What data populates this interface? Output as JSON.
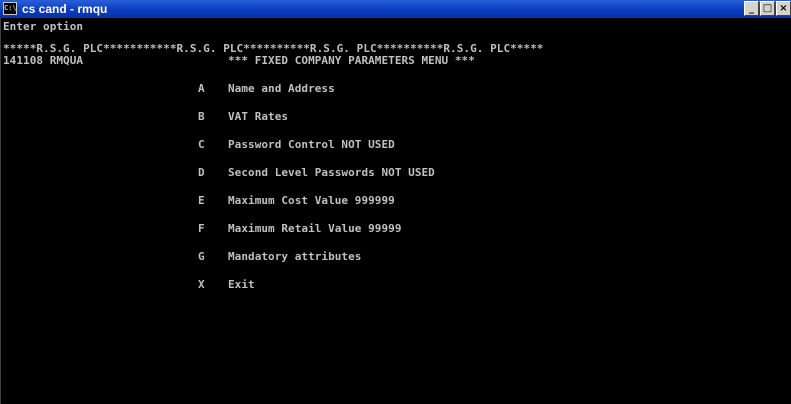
{
  "window": {
    "title": "cs cand - rmqu",
    "icon": "console-icon",
    "icon_glyph": "C:\\",
    "minimize_glyph": "_",
    "restore_glyph": "□",
    "close_glyph": "×"
  },
  "console": {
    "prompt": "Enter option",
    "banner": "*****R.S.G. PLC***********R.S.G. PLC**********R.S.G. PLC**********R.S.G. PLC*****",
    "header_code": "141108 RMQUA",
    "menu_title": "*** FIXED COMPANY PARAMETERS MENU ***",
    "options": [
      {
        "key": "A",
        "label": "Name and Address"
      },
      {
        "key": "B",
        "label": "VAT Rates"
      },
      {
        "key": "C",
        "label": "Password Control NOT USED"
      },
      {
        "key": "D",
        "label": "Second Level Passwords NOT USED"
      },
      {
        "key": "E",
        "label": "Maximum Cost Value 999999"
      },
      {
        "key": "F",
        "label": "Maximum Retail Value 99999"
      },
      {
        "key": "G",
        "label": "Mandatory attributes"
      },
      {
        "key": "X",
        "label": "Exit"
      }
    ]
  }
}
